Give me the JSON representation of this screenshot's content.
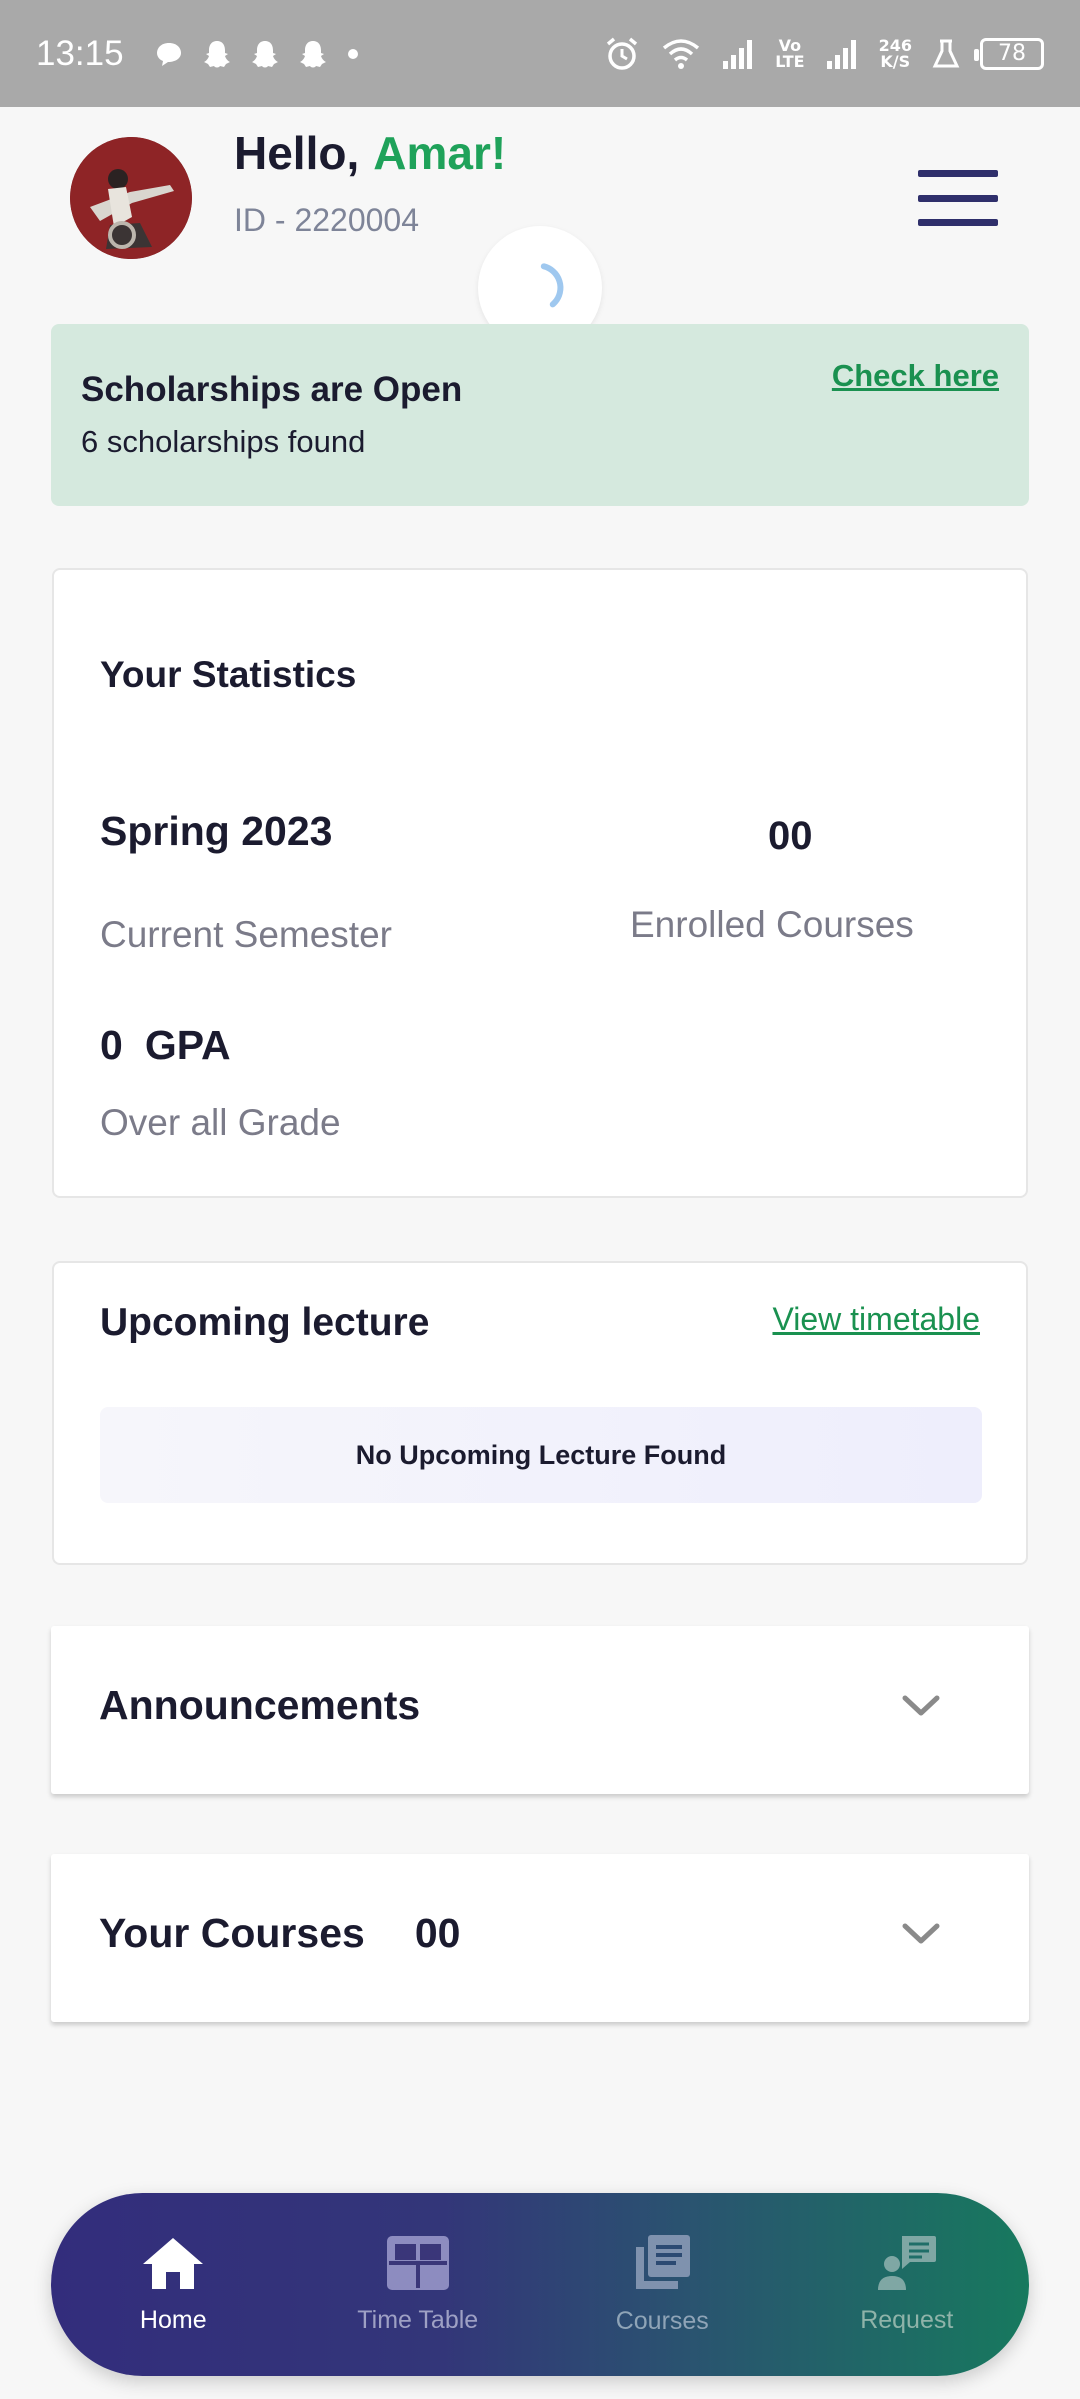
{
  "status_bar": {
    "time": "13:15",
    "volte": "Vo\nLTE",
    "speed_value": "246",
    "speed_unit": "K/S",
    "battery": "78"
  },
  "header": {
    "greeting": "Hello,",
    "name": "Amar!",
    "id_text": "ID - 2220004"
  },
  "scholarship": {
    "title": "Scholarships are Open",
    "subtitle": "6 scholarships found",
    "link": "Check here"
  },
  "statistics": {
    "title": "Your Statistics",
    "semester_value": "Spring 2023",
    "semester_label": "Current Semester",
    "enrolled_value": "00",
    "enrolled_label": "Enrolled Courses",
    "gpa_value": "0",
    "gpa_unit": "GPA",
    "gpa_label": "Over all Grade"
  },
  "upcoming": {
    "title": "Upcoming lecture",
    "link": "View timetable",
    "empty_message": "No Upcoming Lecture Found"
  },
  "announcements": {
    "title": "Announcements"
  },
  "courses": {
    "title": "Your Courses",
    "count": "00"
  },
  "bottom_nav": {
    "items": [
      {
        "label": "Home",
        "icon": "home-icon",
        "active": true
      },
      {
        "label": "Time Table",
        "icon": "table-icon",
        "active": false
      },
      {
        "label": "Courses",
        "icon": "courses-icon",
        "active": false
      },
      {
        "label": "Request",
        "icon": "request-icon",
        "active": false
      }
    ]
  },
  "colors": {
    "accent_green": "#1fa25a",
    "navy": "#2f2f6b",
    "banner_bg": "#d5e9de",
    "muted_text": "#7b7b89"
  }
}
